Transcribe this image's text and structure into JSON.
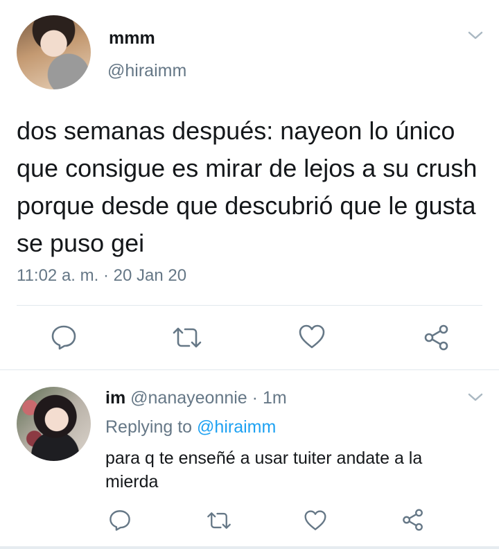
{
  "tweet": {
    "display_name": "mmm",
    "handle": "@hiraimm",
    "text": "dos semanas después: nayeon lo único que consigue es mirar de lejos a su crush porque desde que descubrió que le gusta se puso gei",
    "timestamp": "11:02 a. m. · 20 Jan 20",
    "avatar_icon": "profile-photo",
    "actions": [
      "reply-icon",
      "retweet-icon",
      "like-icon",
      "share-icon"
    ]
  },
  "reply": {
    "display_name": "im",
    "handle": "@nanayeonnie",
    "separator": "·",
    "time": "1m",
    "replying_prefix": "Replying to",
    "replying_to": "@hiraimm",
    "text": "para q te enseñé a usar tuiter andate a la mierda",
    "avatar_icon": "profile-photo",
    "actions": [
      "reply-icon",
      "retweet-icon",
      "like-icon",
      "share-icon"
    ]
  },
  "colors": {
    "text": "#14171a",
    "secondary": "#657786",
    "link": "#1da1f2",
    "divider": "#e1e8ed",
    "chevron": "#aab8c2"
  }
}
